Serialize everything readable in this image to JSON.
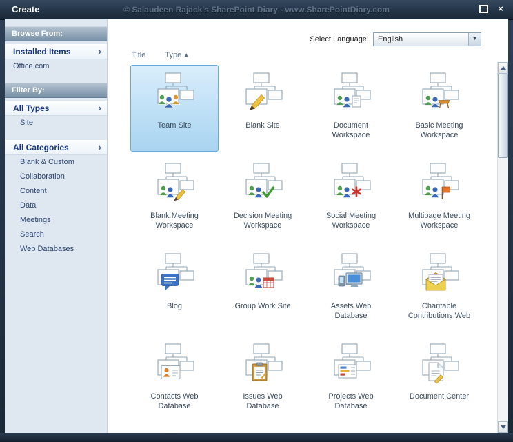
{
  "dialog": {
    "title": "Create",
    "watermark": "© Salaudeen Rajack's SharePoint Diary - www.SharePointDiary.com"
  },
  "icons": {
    "close": "×",
    "chevron_right": "›",
    "dropdown_arrow": "▼",
    "sort_ascending": "▲"
  },
  "colors": {
    "titlebar": "#243548",
    "sidebar_background": "#dfe8f0",
    "selection_border": "#68abdb",
    "selection_fill": "#c3e2f7",
    "header_gradient_top": "#b2c1cf",
    "header_gradient_bottom": "#7890a6"
  },
  "sidebar": {
    "browse_header": "Browse From:",
    "browse_items": [
      {
        "label": "Installed Items",
        "selected": true,
        "sub": false
      },
      {
        "label": "Office.com",
        "selected": false,
        "sub": false
      }
    ],
    "filter_header": "Filter By:",
    "type_items": [
      {
        "label": "All Types",
        "selected": true,
        "sub": false
      },
      {
        "label": "Site",
        "selected": false,
        "sub": true
      }
    ],
    "category_items": [
      {
        "label": "All Categories",
        "selected": true,
        "sub": false
      },
      {
        "label": "Blank & Custom",
        "selected": false,
        "sub": true
      },
      {
        "label": "Collaboration",
        "selected": false,
        "sub": true
      },
      {
        "label": "Content",
        "selected": false,
        "sub": true
      },
      {
        "label": "Data",
        "selected": false,
        "sub": true
      },
      {
        "label": "Meetings",
        "selected": false,
        "sub": true
      },
      {
        "label": "Search",
        "selected": false,
        "sub": true
      },
      {
        "label": "Web Databases",
        "selected": false,
        "sub": true
      }
    ]
  },
  "toolbar": {
    "language_label": "Select Language:",
    "language_value": "English",
    "sort_title": "Title",
    "sort_type": "Type"
  },
  "templates": [
    {
      "label": "Team Site",
      "glyph": "people3",
      "selected": true
    },
    {
      "label": "Blank Site",
      "glyph": "pencil",
      "selected": false
    },
    {
      "label": "Document Workspace",
      "glyph": "people-doc",
      "selected": false
    },
    {
      "label": "Basic Meeting Workspace",
      "glyph": "people-table",
      "selected": false
    },
    {
      "label": "Blank Meeting Workspace",
      "glyph": "people-pencil",
      "selected": false
    },
    {
      "label": "Decision Meeting Workspace",
      "glyph": "people-check",
      "selected": false
    },
    {
      "label": "Social Meeting Workspace",
      "glyph": "people-star",
      "selected": false
    },
    {
      "label": "Multipage Meeting Workspace",
      "glyph": "people-flag",
      "selected": false
    },
    {
      "label": "Blog",
      "glyph": "speech",
      "selected": false
    },
    {
      "label": "Group Work Site",
      "glyph": "people-cal",
      "selected": false
    },
    {
      "label": "Assets Web Database",
      "glyph": "computer",
      "selected": false
    },
    {
      "label": "Charitable Contributions Web",
      "glyph": "envelope",
      "selected": false
    },
    {
      "label": "Contacts Web Database",
      "glyph": "card-person",
      "selected": false
    },
    {
      "label": "Issues Web Database",
      "glyph": "clipboard",
      "selected": false
    },
    {
      "label": "Projects Web Database",
      "glyph": "table-chart",
      "selected": false
    },
    {
      "label": "Document Center",
      "glyph": "page",
      "selected": false
    }
  ]
}
